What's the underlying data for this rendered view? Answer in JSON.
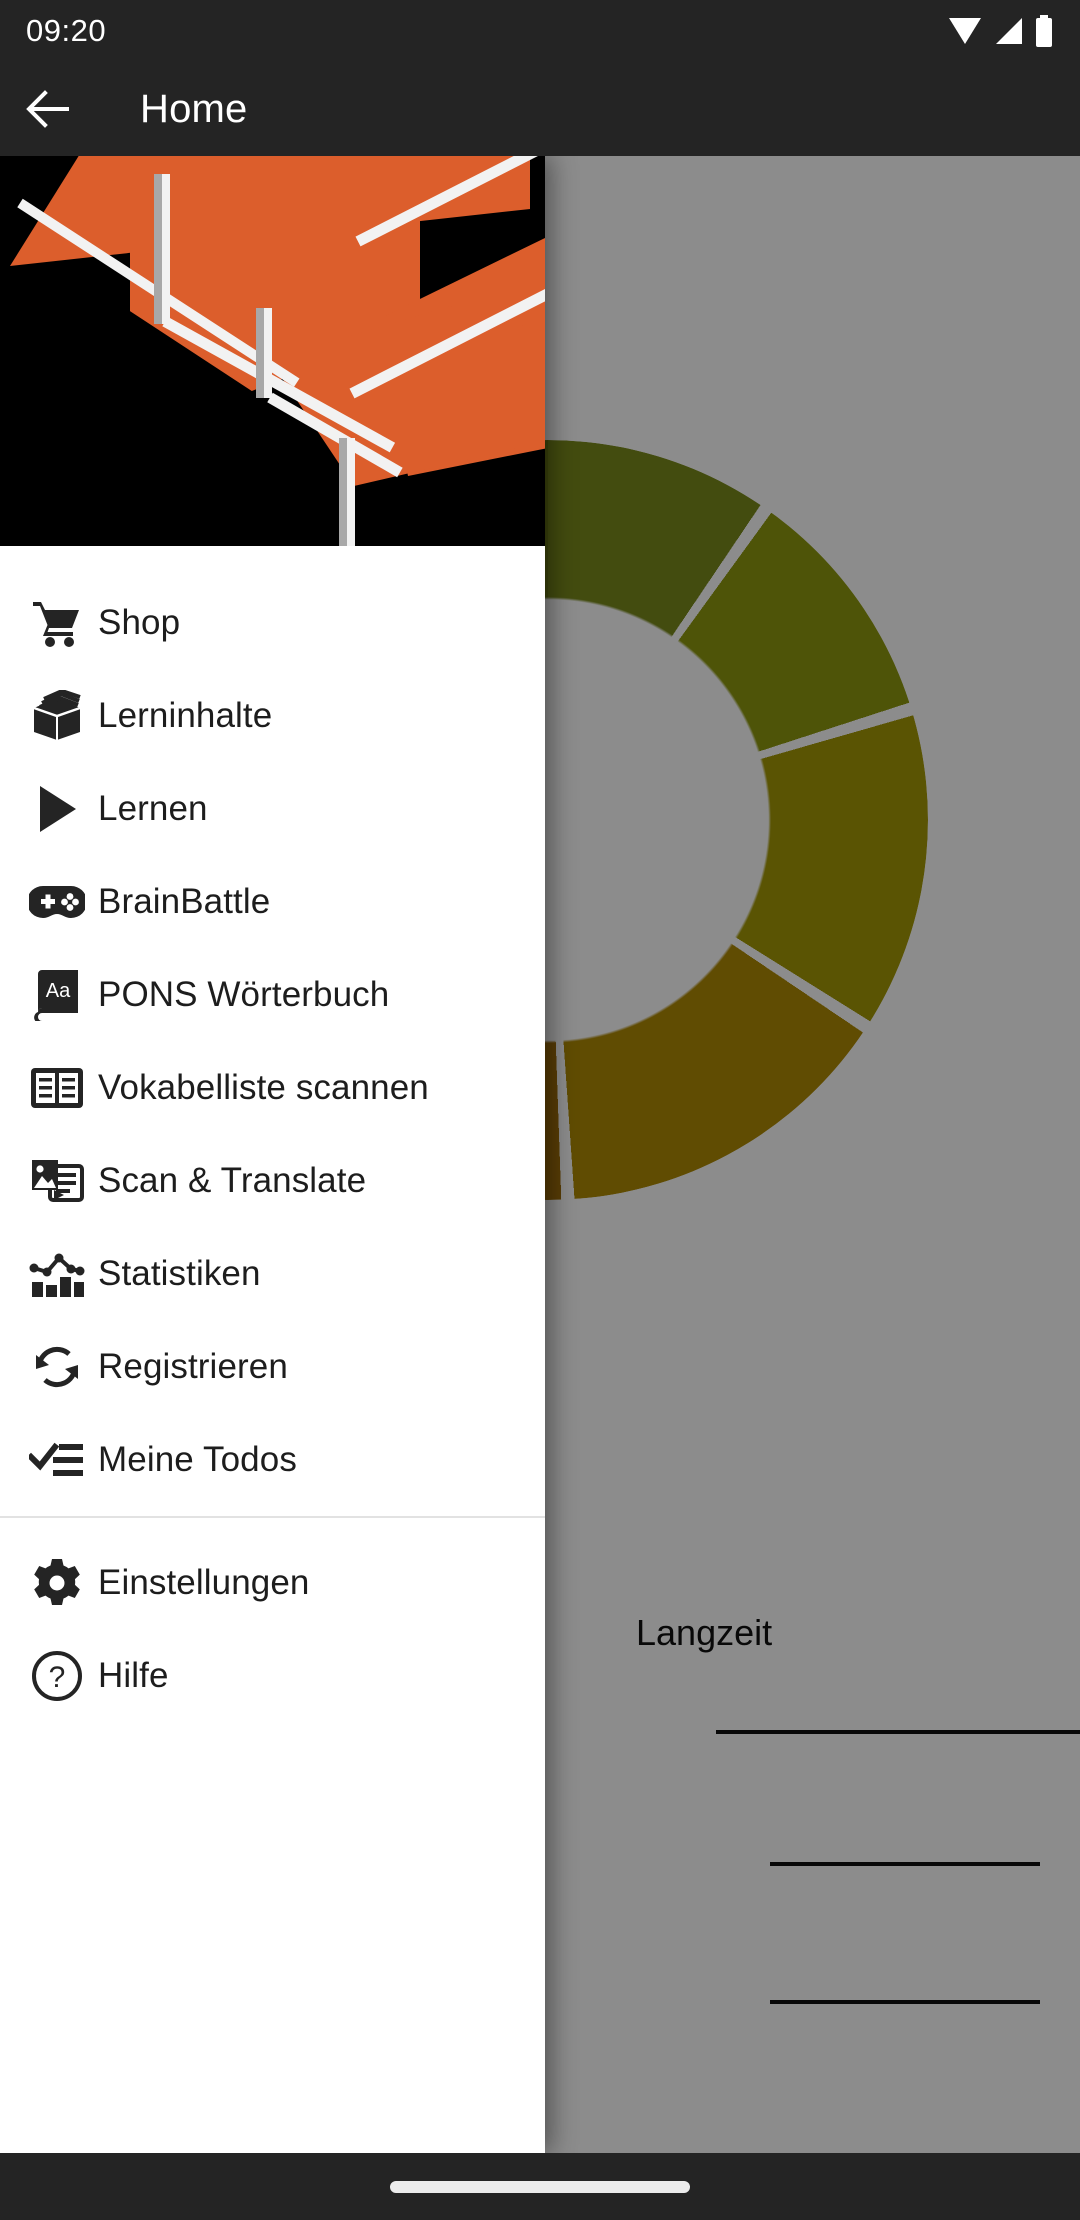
{
  "status_bar": {
    "clock": "09:20",
    "icons": [
      "wifi-icon",
      "cellular-signal-icon",
      "battery-icon"
    ]
  },
  "app_bar": {
    "title": "Home",
    "back_icon": "back-arrow-icon"
  },
  "drawer": {
    "header_image": "orange-3d-blocks-graphic",
    "items": [
      {
        "label": "Shop",
        "icon": "shopping-cart-icon"
      },
      {
        "label": "Lerninhalte",
        "icon": "vocabulary-box-icon"
      },
      {
        "label": "Lernen",
        "icon": "play-icon"
      },
      {
        "label": "BrainBattle",
        "icon": "gamepad-icon"
      },
      {
        "label": "PONS Wörterbuch",
        "icon": "dictionary-book-icon"
      },
      {
        "label": "Vokabelliste scannen",
        "icon": "two-column-list-icon"
      },
      {
        "label": "Scan & Translate",
        "icon": "image-translate-icon"
      },
      {
        "label": "Statistiken",
        "icon": "bar-chart-icon"
      },
      {
        "label": "Registrieren",
        "icon": "sync-icon"
      },
      {
        "label": "Meine Todos",
        "icon": "checklist-icon"
      }
    ],
    "footer_items": [
      {
        "label": "Einstellungen",
        "icon": "gear-icon"
      },
      {
        "label": "Hilfe",
        "icon": "help-circle-icon"
      }
    ]
  },
  "background": {
    "label_langzeit": "Langzeit"
  },
  "nav_bar": {
    "handle": "gesture-home-handle"
  },
  "colors": {
    "accent_orange": "#dc5e2c",
    "app_bar": "#242424",
    "drawer_surface": "#ffffff",
    "text_primary": "#1d1d1d",
    "scrim": "rgba(0,0,0,0.45)"
  }
}
